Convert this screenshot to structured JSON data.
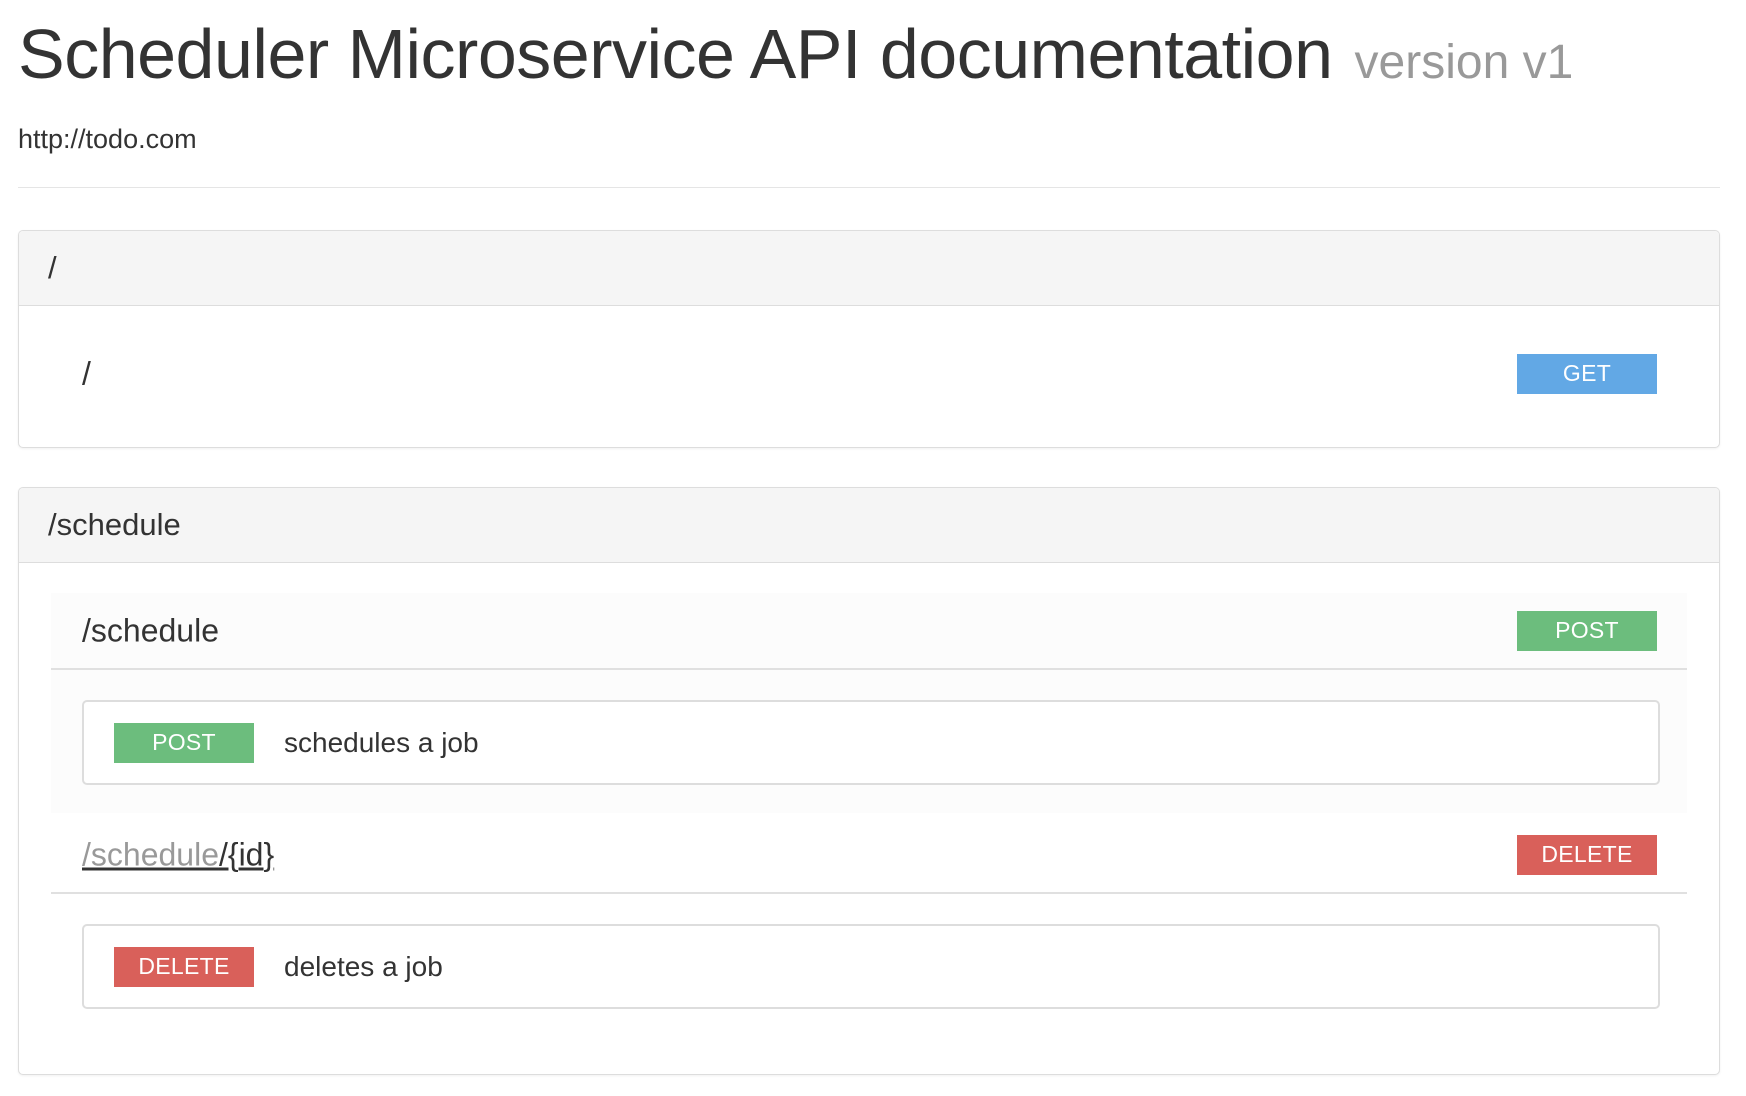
{
  "header": {
    "title": "Scheduler Microservice API documentation",
    "version": "version v1",
    "base_url": "http://todo.com"
  },
  "colors": {
    "get": "#62a8e5",
    "post": "#6cbd7d",
    "delete": "#d9605a"
  },
  "panels": [
    {
      "heading": "/",
      "resources": [
        {
          "path": "/",
          "method": "GET"
        }
      ]
    },
    {
      "heading": "/schedule",
      "resources": [
        {
          "path": "/schedule",
          "method": "POST",
          "operations": [
            {
              "method": "POST",
              "description": "schedules a job"
            }
          ]
        },
        {
          "path_parent": "/schedule",
          "path_child": "/{id}",
          "method": "DELETE",
          "operations": [
            {
              "method": "DELETE",
              "description": "deletes a job"
            }
          ]
        }
      ]
    }
  ]
}
